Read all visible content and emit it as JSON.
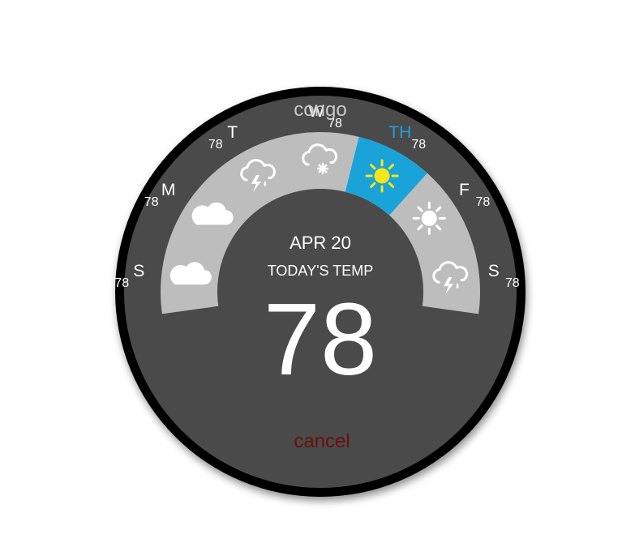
{
  "location": "congo",
  "date": "APR 20",
  "subtitle": "TODAY'S TEMP",
  "current_temp": "78",
  "cancel_label": "cancel",
  "colors": {
    "ring": "#000000",
    "face": "#4a4a4a",
    "band": "#bdbdbd",
    "selected": "#1aa3d9",
    "selected_text": "#1aa3d9",
    "sun": "#f5e61a",
    "text": "#ffffff",
    "location_text": "#c8c8c8",
    "cancel_text": "#6b0f0f"
  },
  "forecast": [
    {
      "day": "S",
      "temp": "78",
      "icon": "cloud-icon",
      "selected": false
    },
    {
      "day": "M",
      "temp": "78",
      "icon": "cloud-icon",
      "selected": false
    },
    {
      "day": "T",
      "temp": "78",
      "icon": "thunder-rain-icon",
      "selected": false
    },
    {
      "day": "W",
      "temp": "78",
      "icon": "snow-cloud-icon",
      "selected": false
    },
    {
      "day": "TH",
      "temp": "78",
      "icon": "sun-icon",
      "selected": true
    },
    {
      "day": "F",
      "temp": "78",
      "icon": "sun-icon",
      "selected": false
    },
    {
      "day": "S",
      "temp": "78",
      "icon": "thunder-rain-icon",
      "selected": false
    }
  ]
}
